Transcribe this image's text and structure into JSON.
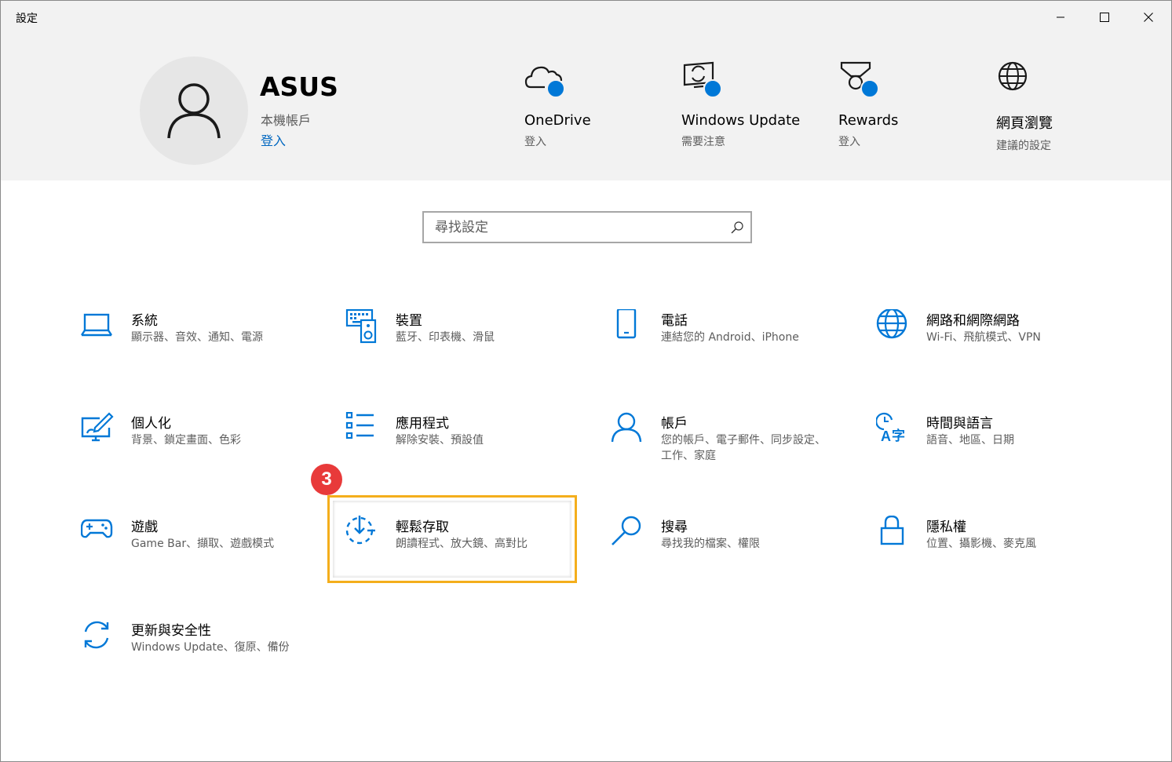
{
  "window": {
    "title": "設定"
  },
  "account": {
    "name": "ASUS",
    "type": "本機帳戶",
    "signin": "登入"
  },
  "quick_links": [
    {
      "title": "OneDrive",
      "subtitle": "登入",
      "icon": "cloud-icon"
    },
    {
      "title": "Windows Update",
      "subtitle": "需要注意",
      "icon": "update-monitor-icon"
    },
    {
      "title": "Rewards",
      "subtitle": "登入",
      "icon": "rewards-medal-icon"
    },
    {
      "title": "網頁瀏覽",
      "subtitle": "建議的設定",
      "icon": "globe-icon"
    }
  ],
  "search": {
    "placeholder": "尋找設定"
  },
  "categories": [
    {
      "title": "系統",
      "subtitle": "顯示器、音效、通知、電源",
      "icon": "laptop-icon"
    },
    {
      "title": "裝置",
      "subtitle": "藍牙、印表機、滑鼠",
      "icon": "keyboard-speaker-icon"
    },
    {
      "title": "電話",
      "subtitle": "連結您的 Android、iPhone",
      "icon": "phone-icon"
    },
    {
      "title": "網路和網際網路",
      "subtitle": "Wi-Fi、飛航模式、VPN",
      "icon": "globe-network-icon"
    },
    {
      "title": "個人化",
      "subtitle": "背景、鎖定畫面、色彩",
      "icon": "personalize-pen-icon"
    },
    {
      "title": "應用程式",
      "subtitle": "解除安裝、預設值",
      "icon": "app-list-icon"
    },
    {
      "title": "帳戶",
      "subtitle": "您的帳戶、電子郵件、同步設定、工作、家庭",
      "icon": "person-icon"
    },
    {
      "title": "時間與語言",
      "subtitle": "語音、地區、日期",
      "icon": "time-language-icon"
    },
    {
      "title": "遊戲",
      "subtitle": "Game Bar、擷取、遊戲模式",
      "icon": "gamepad-icon"
    },
    {
      "title": "輕鬆存取",
      "subtitle": "朗讀程式、放大鏡、高對比",
      "icon": "ease-of-access-icon"
    },
    {
      "title": "搜尋",
      "subtitle": "尋找我的檔案、權限",
      "icon": "magnifier-icon"
    },
    {
      "title": "隱私權",
      "subtitle": "位置、攝影機、麥克風",
      "icon": "lock-icon"
    },
    {
      "title": "更新與安全性",
      "subtitle": "Windows Update、復原、備份",
      "icon": "sync-arrows-icon"
    }
  ],
  "annotation": {
    "step": "3",
    "highlight_color": "#f4ae1c",
    "badge_color": "#e83a3a"
  },
  "colors": {
    "accent": "#0078d7",
    "header_bg": "#f2f2f2"
  }
}
